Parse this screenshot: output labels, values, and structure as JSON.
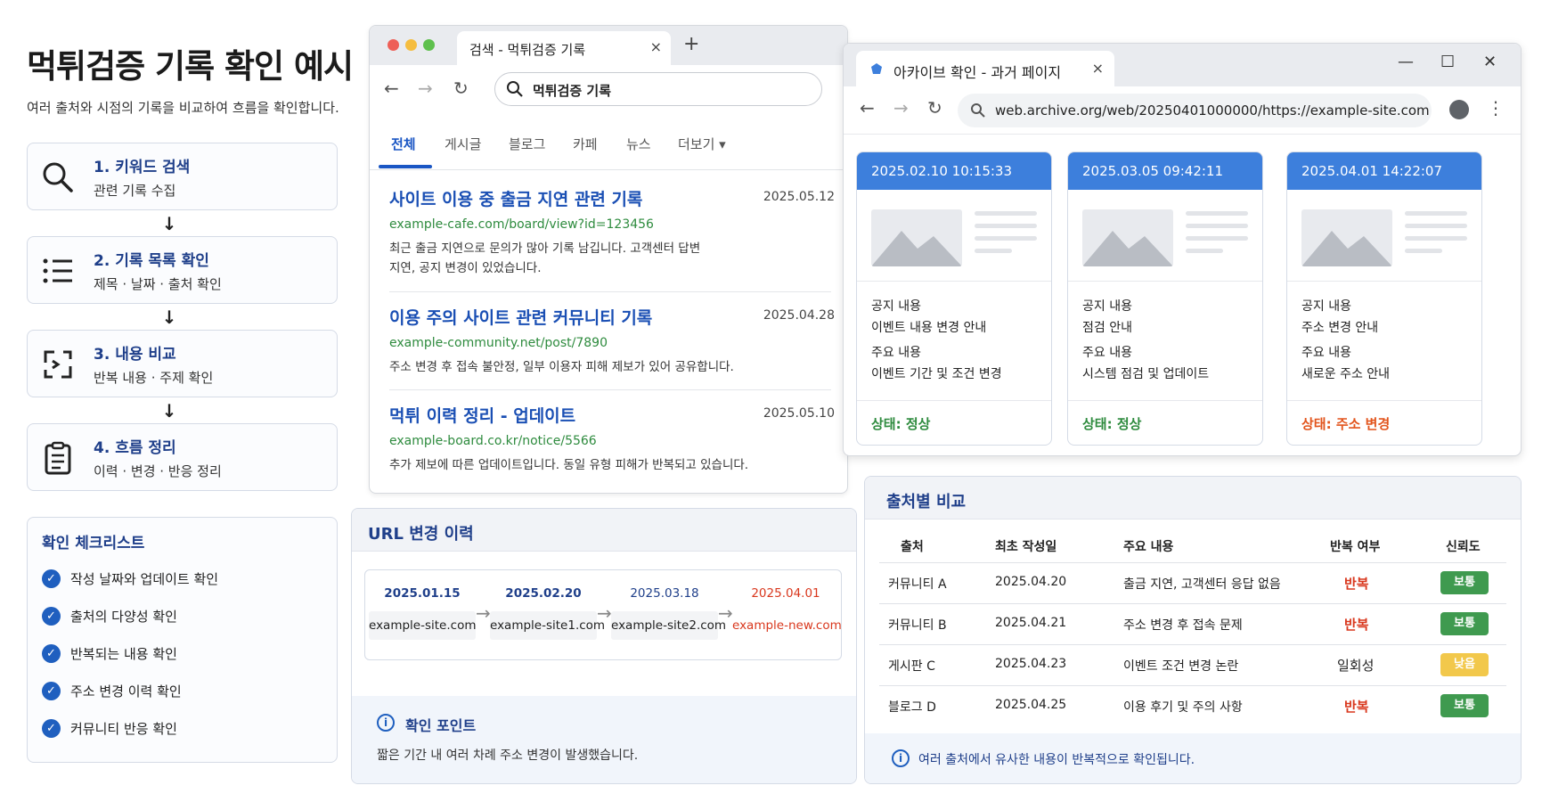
{
  "page": {
    "title": "먹튀검증 기록 확인 예시",
    "subtitle": "여러 출처와 시점의 기록을 비교하여 흐름을 확인합니다."
  },
  "steps": [
    {
      "title": "1. 키워드 검색",
      "desc": "관련 기록 수집",
      "icon": "search-icon"
    },
    {
      "title": "2. 기록 목록 확인",
      "desc": "제목 · 날짜 · 출처 확인",
      "icon": "list-icon"
    },
    {
      "title": "3. 내용 비교",
      "desc": "반복 내용 · 주제 확인",
      "icon": "compare-icon"
    },
    {
      "title": "4. 흐름 정리",
      "desc": "이력 · 변경 · 반응 정리",
      "icon": "clipboard-icon"
    }
  ],
  "checklist": {
    "title": "확인 체크리스트",
    "items": [
      "작성 날짜와 업데이트 확인",
      "출처의 다양성 확인",
      "반복되는 내용 확인",
      "주소 변경 이력 확인",
      "커뮤니티 반응 확인"
    ]
  },
  "search_browser": {
    "tab_title": "검색 - 먹튀검증 기록",
    "tab_close": "×",
    "new_tab": "+",
    "query": "먹튀검증 기록",
    "tabs": [
      "전체",
      "게시글",
      "블로그",
      "카페",
      "뉴스",
      "더보기 ▾"
    ],
    "results": [
      {
        "title": "사이트 이용 중 출금 지연 관련 기록",
        "date": "2025.05.12",
        "url": "example-cafe.com/board/view?id=123456",
        "desc1": "최근 출금 지연으로 문의가 많아 기록 남깁니다. 고객센터 답변",
        "desc2": "지연, 공지 변경이 있었습니다."
      },
      {
        "title": "이용 주의 사이트 관련 커뮤니티 기록",
        "date": "2025.04.28",
        "url": "example-community.net/post/7890",
        "desc1": "주소 변경 후 접속 불안정, 일부 이용자 피해 제보가 있어 공유합니다.",
        "desc2": ""
      },
      {
        "title": "먹튀 이력 정리 - 업데이트",
        "date": "2025.05.10",
        "url": "example-board.co.kr/notice/5566",
        "desc1": "추가 제보에 따른 업데이트입니다. 동일 유형 피해가 반복되고 있습니다.",
        "desc2": ""
      }
    ]
  },
  "archive_browser": {
    "tab_title": "아카이브 확인 - 과거 페이지",
    "tab_close": "×",
    "url": "web.archive.org/web/20250401000000/https://example-site.com",
    "snapshots": [
      {
        "timestamp": "2025.02.10 10:15:33",
        "label1": "공지 내용",
        "value1": "이벤트 내용 변경 안내",
        "label2": "주요 내용",
        "value2": "이벤트 기간 및 조건 변경",
        "status": "상태: 정상",
        "status_color": "#2e8b3e"
      },
      {
        "timestamp": "2025.03.05 09:42:11",
        "label1": "공지 내용",
        "value1": "점검 안내",
        "label2": "주요 내용",
        "value2": "시스템 점검 및 업데이트",
        "status": "상태: 정상",
        "status_color": "#2e8b3e"
      },
      {
        "timestamp": "2025.04.01 14:22:07",
        "label1": "공지 내용",
        "value1": "주소 변경 안내",
        "label2": "주요 내용",
        "value2": "새로운 주소 안내",
        "status": "상태: 주소 변경",
        "status_color": "#e2541c"
      }
    ]
  },
  "url_history": {
    "title": "URL 변경 이력",
    "entries": [
      {
        "date": "2025.01.15",
        "url": "example-site.com"
      },
      {
        "date": "2025.02.20",
        "url": "example-site1.com"
      },
      {
        "date": "2025.03.18",
        "url": "example-site2.com"
      },
      {
        "date": "2025.04.01",
        "url": "example-new.com"
      }
    ],
    "note_title": "확인 포인트",
    "note_text": "짧은 기간 내 여러 차례 주소 변경이 발생했습니다."
  },
  "source_compare": {
    "title": "출처별 비교",
    "headers": [
      "출처",
      "최초 작성일",
      "주요 내용",
      "반복 여부",
      "신뢰도"
    ],
    "rows": [
      {
        "source": "커뮤니티 A",
        "date": "2025.04.20",
        "content": "출금 지연, 고객센터 응답 없음",
        "repeat": "반복",
        "trust": "보통"
      },
      {
        "source": "커뮤니티 B",
        "date": "2025.04.21",
        "content": "주소 변경 후 접속 문제",
        "repeat": "반복",
        "trust": "보통"
      },
      {
        "source": "게시판 C",
        "date": "2025.04.23",
        "content": "이벤트 조건 변경 논란",
        "repeat": "일회성",
        "trust": "낮음"
      },
      {
        "source": "블로그 D",
        "date": "2025.04.25",
        "content": "이용 후기 및 주의 사항",
        "repeat": "반복",
        "trust": "보통"
      }
    ],
    "note_text": "여러 출처에서 유사한 내용이 반복적으로 확인됩니다."
  },
  "colors": {
    "accent": "#1f3f8a",
    "link": "#1a4fb4",
    "url_green": "#2e8b3e",
    "warn": "#d9381e",
    "snapshot_header": "#3d7fdc"
  }
}
